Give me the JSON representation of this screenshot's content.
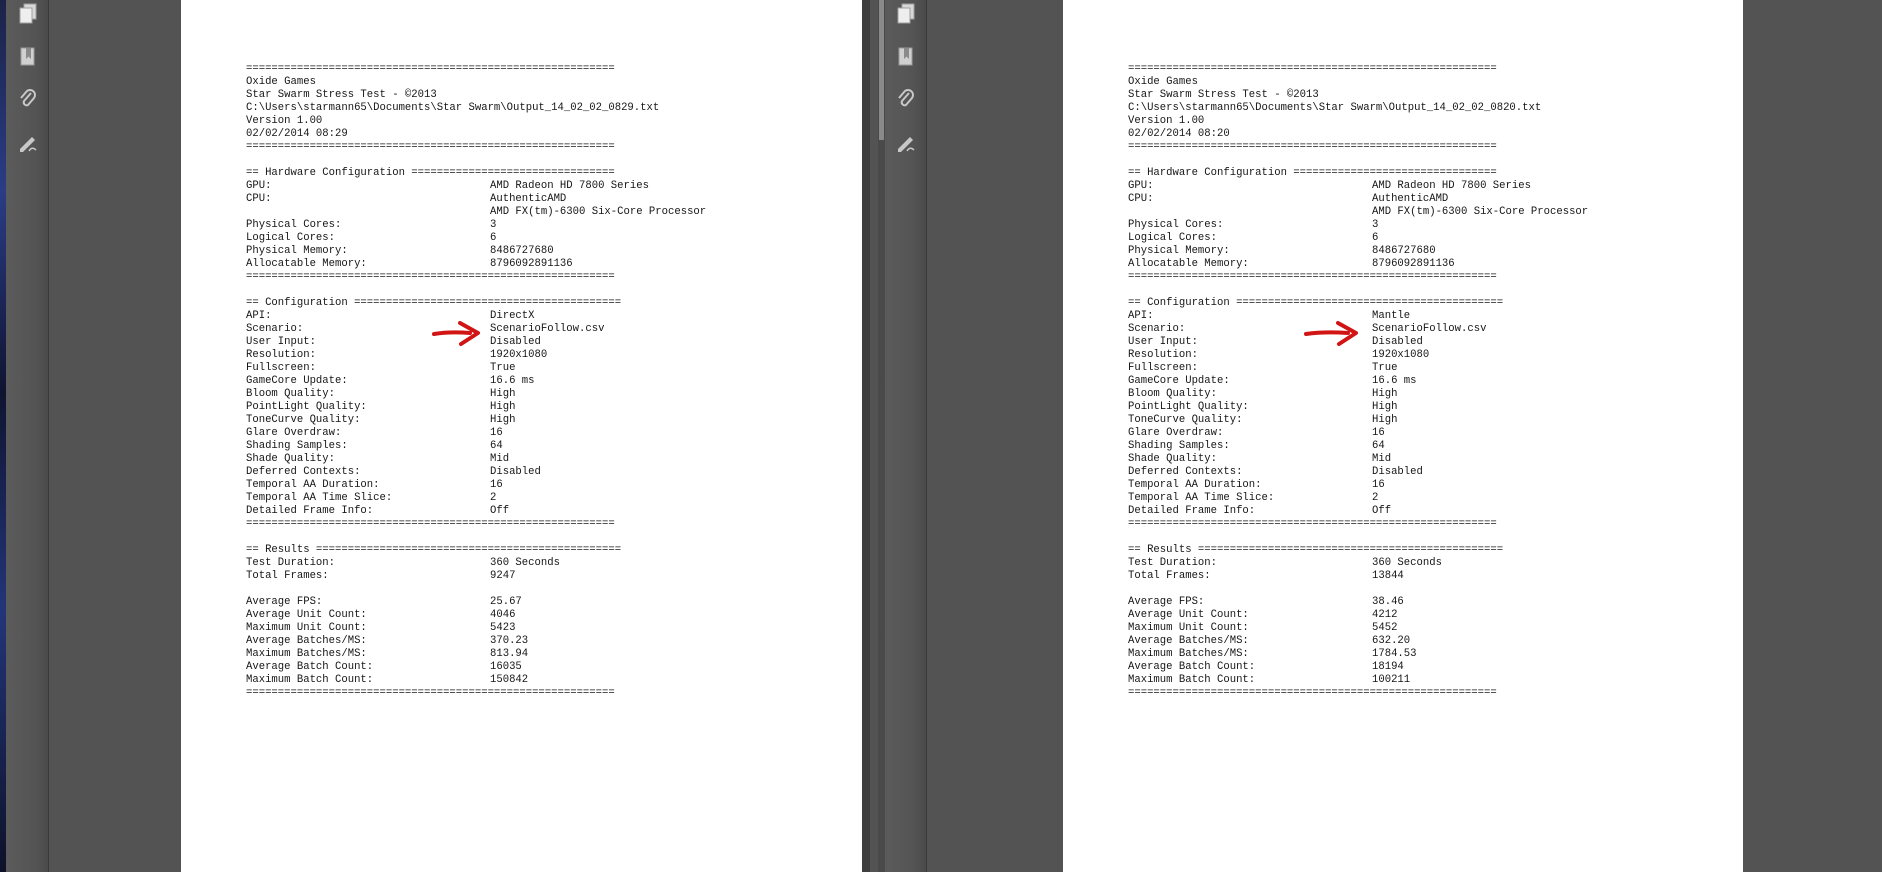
{
  "toolbar_icons": [
    "pages-icon",
    "bookmark-icon",
    "attachment-icon",
    "signature-icon"
  ],
  "documents": [
    {
      "header": [
        "Oxide Games",
        "Star Swarm Stress Test - ©2013",
        "C:\\Users\\starmann65\\Documents\\Star Swarm\\Output_14_02_02_0829.txt",
        "Version 1.00",
        "02/02/2014 08:29"
      ],
      "hardware_title": "== Hardware Configuration ================================",
      "hardware": [
        {
          "key": "GPU:",
          "value": "AMD Radeon HD 7800 Series"
        },
        {
          "key": "CPU:",
          "value": "AuthenticAMD"
        },
        {
          "key": "",
          "value": "AMD FX(tm)-6300 Six-Core Processor"
        },
        {
          "key": "Physical Cores:",
          "value": "3"
        },
        {
          "key": "Logical Cores:",
          "value": "6"
        },
        {
          "key": "Physical Memory:",
          "value": "8486727680"
        },
        {
          "key": "Allocatable Memory:",
          "value": "8796092891136"
        }
      ],
      "config_title": "== Configuration ==========================================",
      "config": [
        {
          "key": "API:",
          "value": "DirectX"
        },
        {
          "key": "Scenario:",
          "value": "ScenarioFollow.csv"
        },
        {
          "key": "User Input:",
          "value": "Disabled"
        },
        {
          "key": "Resolution:",
          "value": "1920x1080"
        },
        {
          "key": "Fullscreen:",
          "value": "True"
        },
        {
          "key": "GameCore Update:",
          "value": "16.6 ms"
        },
        {
          "key": "Bloom Quality:",
          "value": "High"
        },
        {
          "key": "PointLight Quality:",
          "value": "High"
        },
        {
          "key": "ToneCurve Quality:",
          "value": "High"
        },
        {
          "key": "Glare Overdraw:",
          "value": "16"
        },
        {
          "key": "Shading Samples:",
          "value": "64"
        },
        {
          "key": "Shade Quality:",
          "value": "Mid"
        },
        {
          "key": "Deferred Contexts:",
          "value": "Disabled"
        },
        {
          "key": "Temporal AA Duration:",
          "value": "16"
        },
        {
          "key": "Temporal AA Time Slice:",
          "value": "2"
        },
        {
          "key": "Detailed Frame Info:",
          "value": "Off"
        }
      ],
      "results_title": "== Results ================================================",
      "results_a": [
        {
          "key": "Test Duration:",
          "value": "360 Seconds"
        },
        {
          "key": "Total Frames:",
          "value": "9247"
        }
      ],
      "results_b": [
        {
          "key": "Average FPS:",
          "value": "25.67"
        },
        {
          "key": "Average Unit Count:",
          "value": "4046"
        },
        {
          "key": "Maximum Unit Count:",
          "value": "5423"
        },
        {
          "key": "Average Batches/MS:",
          "value": "370.23"
        },
        {
          "key": "Maximum Batches/MS:",
          "value": "813.94"
        },
        {
          "key": "Average Batch Count:",
          "value": "16035"
        },
        {
          "key": "Maximum Batch Count:",
          "value": "150842"
        }
      ]
    },
    {
      "header": [
        "Oxide Games",
        "Star Swarm Stress Test - ©2013",
        "C:\\Users\\starmann65\\Documents\\Star Swarm\\Output_14_02_02_0820.txt",
        "Version 1.00",
        "02/02/2014 08:20"
      ],
      "hardware_title": "== Hardware Configuration ================================",
      "hardware": [
        {
          "key": "GPU:",
          "value": "AMD Radeon HD 7800 Series"
        },
        {
          "key": "CPU:",
          "value": "AuthenticAMD"
        },
        {
          "key": "",
          "value": "AMD FX(tm)-6300 Six-Core Processor"
        },
        {
          "key": "Physical Cores:",
          "value": "3"
        },
        {
          "key": "Logical Cores:",
          "value": "6"
        },
        {
          "key": "Physical Memory:",
          "value": "8486727680"
        },
        {
          "key": "Allocatable Memory:",
          "value": "8796092891136"
        }
      ],
      "config_title": "== Configuration ==========================================",
      "config": [
        {
          "key": "API:",
          "value": "Mantle"
        },
        {
          "key": "Scenario:",
          "value": "ScenarioFollow.csv"
        },
        {
          "key": "User Input:",
          "value": "Disabled"
        },
        {
          "key": "Resolution:",
          "value": "1920x1080"
        },
        {
          "key": "Fullscreen:",
          "value": "True"
        },
        {
          "key": "GameCore Update:",
          "value": "16.6 ms"
        },
        {
          "key": "Bloom Quality:",
          "value": "High"
        },
        {
          "key": "PointLight Quality:",
          "value": "High"
        },
        {
          "key": "ToneCurve Quality:",
          "value": "High"
        },
        {
          "key": "Glare Overdraw:",
          "value": "16"
        },
        {
          "key": "Shading Samples:",
          "value": "64"
        },
        {
          "key": "Shade Quality:",
          "value": "Mid"
        },
        {
          "key": "Deferred Contexts:",
          "value": "Disabled"
        },
        {
          "key": "Temporal AA Duration:",
          "value": "16"
        },
        {
          "key": "Temporal AA Time Slice:",
          "value": "2"
        },
        {
          "key": "Detailed Frame Info:",
          "value": "Off"
        }
      ],
      "results_title": "== Results ================================================",
      "results_a": [
        {
          "key": "Test Duration:",
          "value": "360 Seconds"
        },
        {
          "key": "Total Frames:",
          "value": "13844"
        }
      ],
      "results_b": [
        {
          "key": "Average FPS:",
          "value": "38.46"
        },
        {
          "key": "Average Unit Count:",
          "value": "4212"
        },
        {
          "key": "Maximum Unit Count:",
          "value": "5452"
        },
        {
          "key": "Average Batches/MS:",
          "value": "632.20"
        },
        {
          "key": "Maximum Batches/MS:",
          "value": "1784.53"
        },
        {
          "key": "Average Batch Count:",
          "value": "18194"
        },
        {
          "key": "Maximum Batch Count:",
          "value": "100211"
        }
      ]
    }
  ],
  "separator": "==========================================================",
  "colors": {
    "arrow": "#d11414",
    "page": "#ffffff",
    "viewer_bg": "#535353",
    "text": "#161616"
  }
}
